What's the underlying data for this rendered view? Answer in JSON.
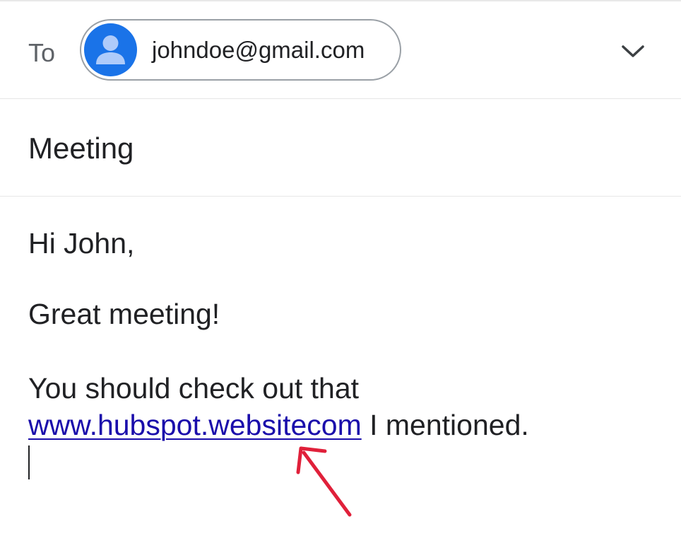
{
  "header": {
    "to_label": "To",
    "recipient_email": "johndoe@gmail.com"
  },
  "subject": "Meeting",
  "body": {
    "greeting": "Hi John,",
    "line2": "Great meeting!",
    "line3": "You should check out that",
    "link_text": "www.hubspot.websitecom",
    "after_link": " I mentioned."
  },
  "icons": {
    "avatar": "person-avatar-icon",
    "expand": "chevron-down-icon",
    "annotation": "red-arrow-annotation"
  },
  "colors": {
    "avatar_bg": "#1a73e8",
    "link": "#1a0dab",
    "annotation_arrow": "#e0203a"
  }
}
